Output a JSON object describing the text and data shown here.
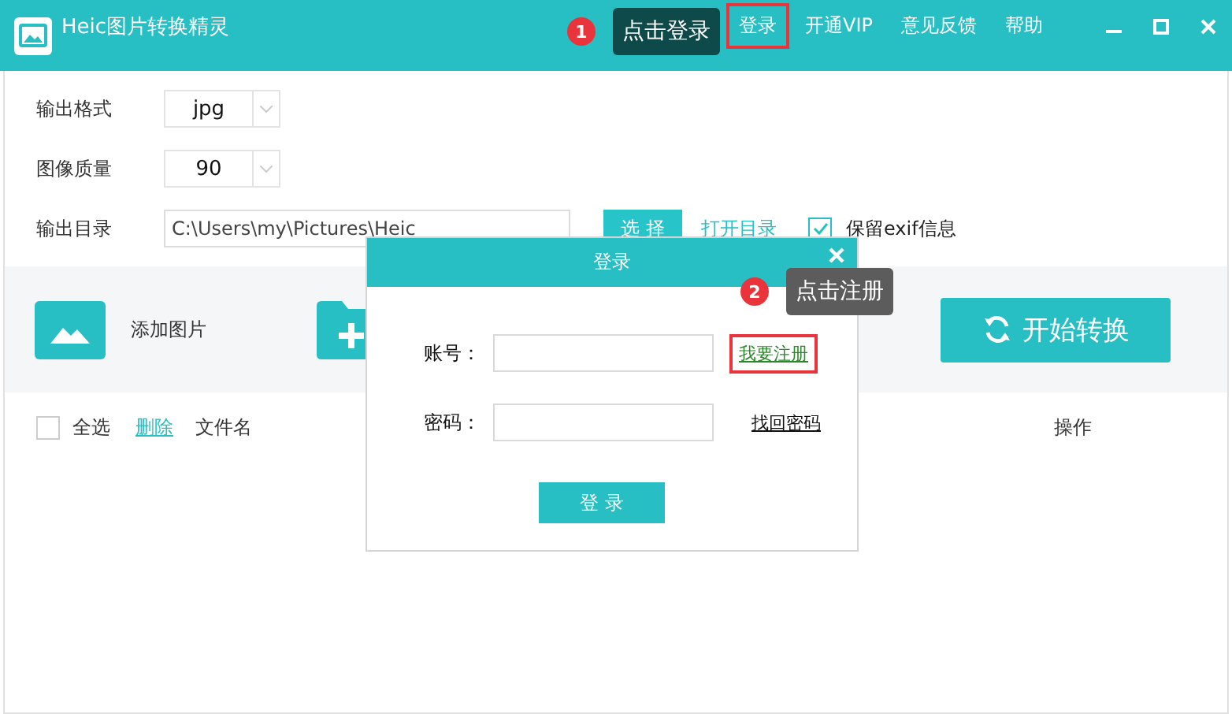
{
  "window": {
    "title": "Heic图片转换精灵"
  },
  "title_menu": [
    {
      "label": "登录",
      "highlighted": true
    },
    {
      "label": "开通VIP",
      "highlighted": false
    },
    {
      "label": "意见反馈",
      "highlighted": false
    },
    {
      "label": "帮助",
      "highlighted": false
    }
  ],
  "settings": {
    "format": {
      "label": "输出格式",
      "value": "jpg"
    },
    "quality": {
      "label": "图像质量",
      "value": "90"
    },
    "output_dir": {
      "label": "输出目录",
      "value": "C:\\Users\\my\\Pictures\\Heic",
      "choose_button": "选 择",
      "open_link": "打开目录",
      "keep_exif": {
        "label": "保留exif信息",
        "checked": true
      }
    }
  },
  "toolbar": {
    "add_image": "添加图片",
    "start_button": "开始转换"
  },
  "table": {
    "select_all": {
      "label": "全选",
      "checked": false
    },
    "delete_link": "删除",
    "columns": [
      "文件名",
      "操作"
    ]
  },
  "login_dialog": {
    "title": "登录",
    "fields": [
      {
        "label": "账号：",
        "link": "我要注册",
        "highlighted": true
      },
      {
        "label": "密码：",
        "link": "找回密码",
        "highlighted": false
      }
    ],
    "submit": "登 录"
  },
  "annotations": [
    {
      "number": "1",
      "text": "点击登录"
    },
    {
      "number": "2",
      "text": "点击注册"
    }
  ]
}
